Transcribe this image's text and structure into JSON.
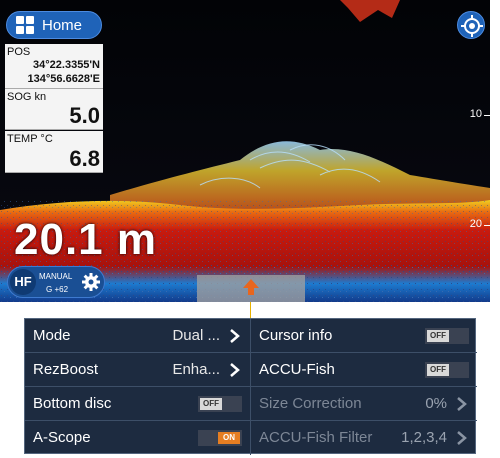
{
  "header": {
    "home_label": "Home"
  },
  "position": {
    "caption": "POS",
    "lat": "34°22.3355'N",
    "lon": "134°56.6628'E"
  },
  "sog": {
    "caption": "SOG kn",
    "value": "5.0"
  },
  "temp": {
    "caption": "TEMP °C",
    "value": "6.8"
  },
  "scale": {
    "tick_10": "10",
    "tick_20": "20"
  },
  "depth": {
    "value": "20.1 m"
  },
  "sonar_mode": {
    "frequency": "HF",
    "gain_mode": "MANUAL",
    "gain_value": "G +62"
  },
  "menu": {
    "left": [
      {
        "label": "Mode",
        "value": "Dual ...",
        "control": "chevron"
      },
      {
        "label": "RezBoost",
        "value": "Enha...",
        "control": "chevron"
      },
      {
        "label": "Bottom disc",
        "toggle": "OFF"
      },
      {
        "label": "A-Scope",
        "toggle": "ON"
      }
    ],
    "right": [
      {
        "label": "Cursor info",
        "toggle": "OFF"
      },
      {
        "label": "ACCU-Fish",
        "toggle": "OFF"
      },
      {
        "label": "Size Correction",
        "value": "0%",
        "control": "chevron",
        "disabled": true
      },
      {
        "label": "ACCU-Fish Filter",
        "value": "1,2,3,4",
        "control": "chevron",
        "disabled": true
      }
    ]
  },
  "colors": {
    "accent_blue": "#1f63b8",
    "toggle_on": "#e67e22",
    "menu_bg": "#1d2b40"
  }
}
